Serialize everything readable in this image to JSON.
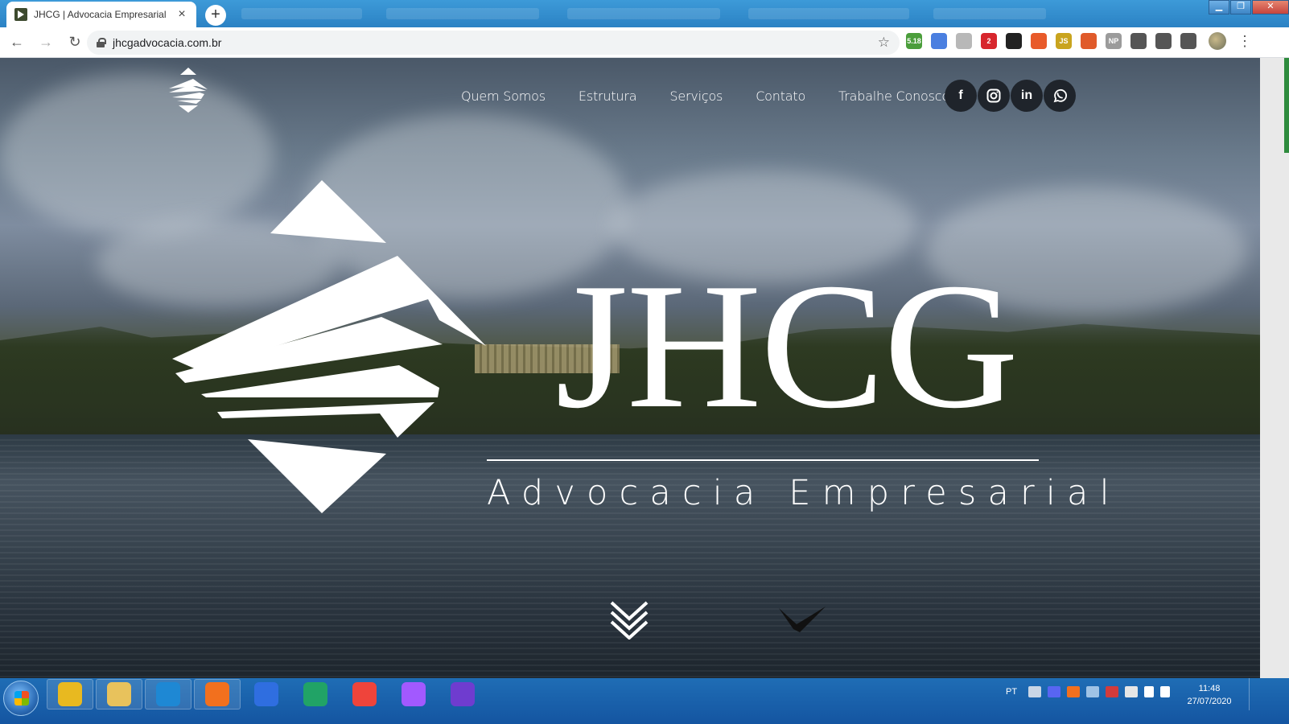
{
  "browser": {
    "tab_title": "JHCG | Advocacia Empresarial",
    "new_tab_label": "+",
    "url": "jhcgadvocacia.com.br",
    "window_controls": [
      "minimize-icon",
      "restore-icon",
      "close-icon"
    ],
    "extensions": [
      {
        "name": "android-ext-icon",
        "badge": "5.18",
        "color": "#4b9e3b"
      },
      {
        "name": "translate-ext-icon",
        "badge": "",
        "color": "#4a7fe0"
      },
      {
        "name": "compass-ext-icon",
        "badge": "",
        "color": "#b8b8b8"
      },
      {
        "name": "opera-ext-icon",
        "badge": "2",
        "color": "#d7262d"
      },
      {
        "name": "glasses-ext-icon",
        "badge": "",
        "color": "#222222"
      },
      {
        "name": "color-wheel-ext-icon",
        "badge": "",
        "color": "#e85a2a"
      },
      {
        "name": "js-ext-icon",
        "badge": "JS",
        "color": "#c9a41e"
      },
      {
        "name": "fire-ext-icon",
        "badge": "",
        "color": "#e05a2a"
      },
      {
        "name": "np-ext-icon",
        "badge": "NP",
        "color": "#9b9b9b"
      },
      {
        "name": "reader-ext-icon",
        "badge": "",
        "color": "#555555"
      },
      {
        "name": "puzzle-ext-icon",
        "badge": "",
        "color": "#555555"
      },
      {
        "name": "media-queue-ext-icon",
        "badge": "",
        "color": "#555555"
      }
    ]
  },
  "site": {
    "nav": [
      "Quem Somos",
      "Estrutura",
      "Serviços",
      "Contato",
      "Trabalhe Conosco"
    ],
    "socials": [
      {
        "name": "facebook-icon",
        "glyph": "f"
      },
      {
        "name": "instagram-icon",
        "glyph": ""
      },
      {
        "name": "linkedin-icon",
        "glyph": "in"
      },
      {
        "name": "whatsapp-icon",
        "glyph": ""
      }
    ],
    "wordmark": "JHCG",
    "tagline": "Advocacia Empresarial",
    "accent_color": "#ffffff"
  },
  "taskbar": {
    "apps": [
      {
        "name": "chrome-taskbar-icon",
        "color": "#e8b920"
      },
      {
        "name": "explorer-taskbar-icon",
        "color": "#e8c25c"
      },
      {
        "name": "vscode-taskbar-icon",
        "color": "#1e88d4"
      },
      {
        "name": "xampp-taskbar-icon",
        "color": "#f2701e"
      },
      {
        "name": "wps-taskbar-icon",
        "color": "#2f6ee0"
      },
      {
        "name": "edge-taskbar-icon",
        "color": "#21a366"
      },
      {
        "name": "anydesk-taskbar-icon",
        "color": "#ef443b"
      },
      {
        "name": "figma-taskbar-icon",
        "color": "#a259ff"
      },
      {
        "name": "music-taskbar-icon",
        "color": "#6f3ccf"
      }
    ],
    "language": "PT",
    "time": "11:48",
    "date": "27/07/2020"
  }
}
